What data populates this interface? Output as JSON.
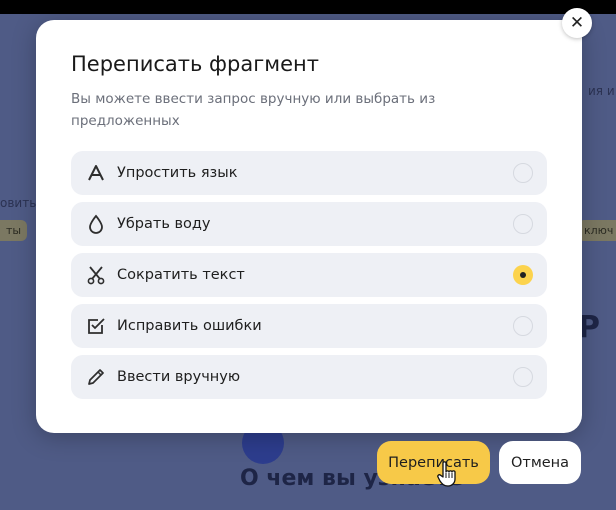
{
  "modal": {
    "title": "Переписать фрагмент",
    "subtitle": "Вы можете ввести запрос вручную или выбрать из предложенных",
    "options": [
      {
        "label": "Упростить язык",
        "icon": "letter-a-icon",
        "selected": false
      },
      {
        "label": "Убрать воду",
        "icon": "drop-icon",
        "selected": false
      },
      {
        "label": "Сократить текст",
        "icon": "scissors-icon",
        "selected": true
      },
      {
        "label": "Исправить ошибки",
        "icon": "checkbox-icon",
        "selected": false
      },
      {
        "label": "Ввести вручную",
        "icon": "pencil-icon",
        "selected": false
      }
    ]
  },
  "actions": {
    "primary_label": "Переписать",
    "secondary_label": "Отмена"
  },
  "background": {
    "heading": "О чем вы узнаете",
    "frag_right_top": "ия и с",
    "frag_left_mid": "овить",
    "chip_left": "ты",
    "chip_right": "ключ",
    "big_letter": "Р"
  },
  "colors": {
    "accent": "#f7c948",
    "overlay": "#4f5b86",
    "option_bg": "#eef0f5"
  }
}
